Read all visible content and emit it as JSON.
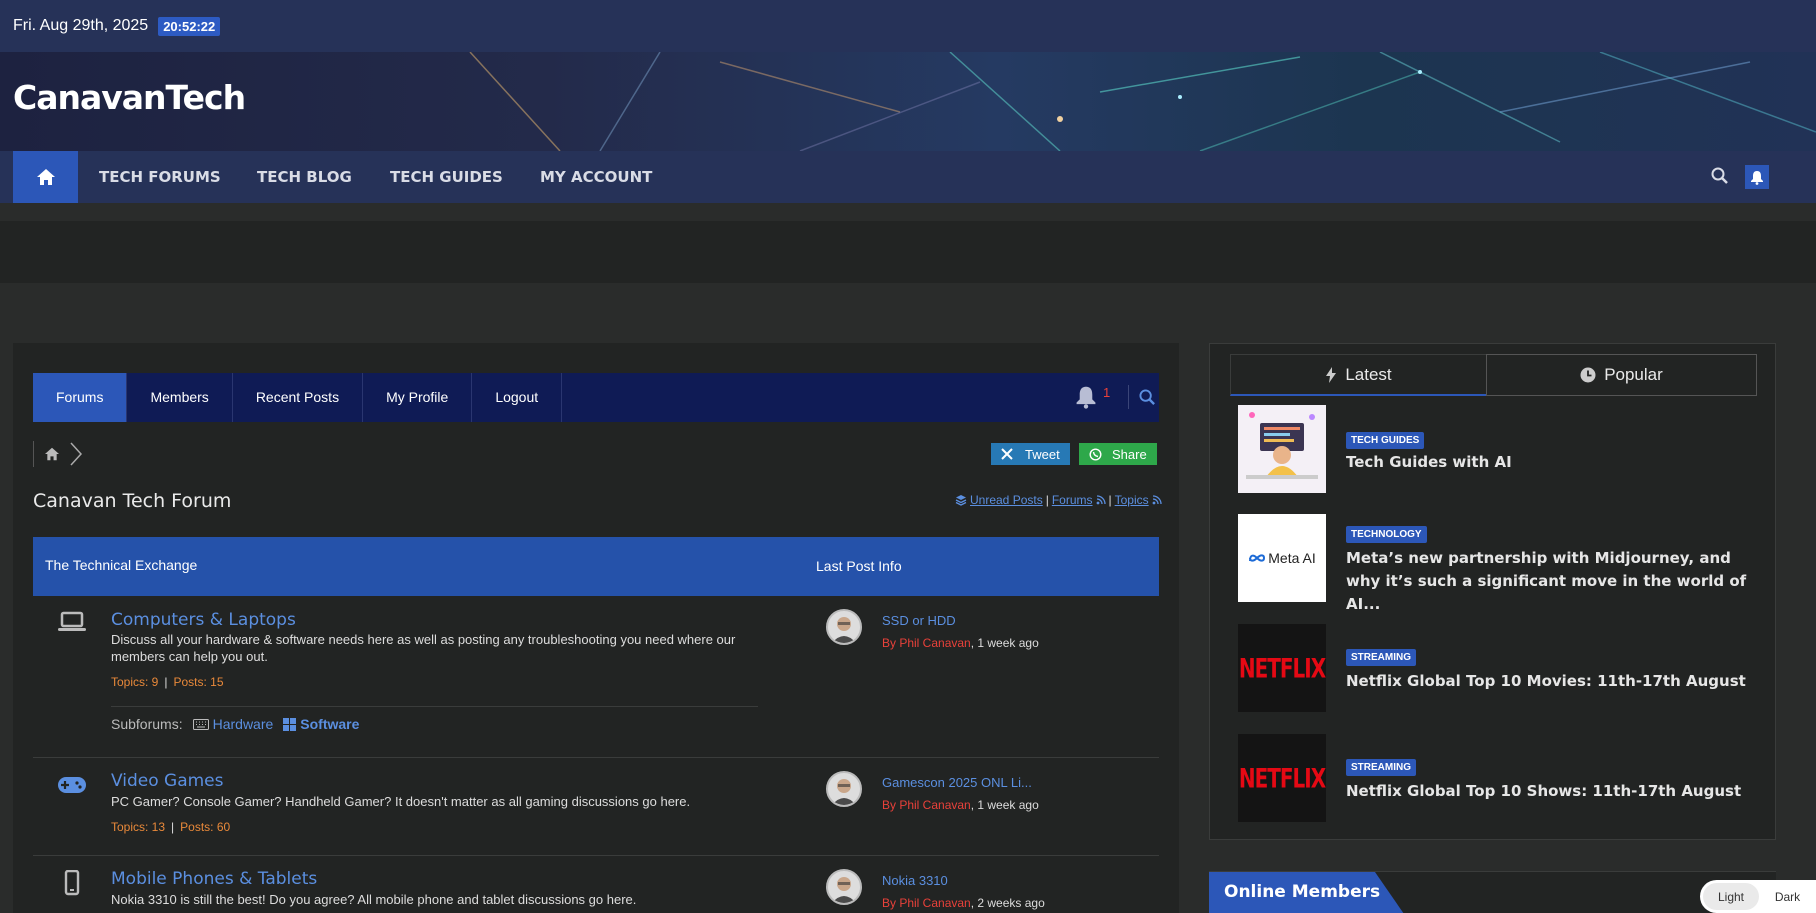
{
  "topbar": {
    "date": "Fri. Aug 29th, 2025",
    "time": "20:52:22"
  },
  "brand": "CanavanTech",
  "nav": {
    "items": [
      "TECH FORUMS",
      "TECH BLOG",
      "TECH GUIDES",
      "MY ACCOUNT"
    ],
    "icons": [
      "home-icon",
      "search-icon",
      "bell-icon"
    ]
  },
  "forum_tabs": {
    "items": [
      "Forums",
      "Members",
      "Recent Posts",
      "My Profile",
      "Logout"
    ],
    "notification_count": "1"
  },
  "share": {
    "tweet": "Tweet",
    "share": "Share"
  },
  "forum": {
    "title": "Canavan Tech Forum",
    "links": {
      "unread": "Unread Posts",
      "forums": "Forums",
      "topics": "Topics",
      "sep": "|"
    },
    "header": {
      "section": "The Technical Exchange",
      "last_post": "Last Post Info"
    }
  },
  "rows": [
    {
      "name": "Computers & Laptops",
      "desc": "Discuss all your hardware & software needs here as well as posting any troubleshooting you need where our members can help you out.",
      "topics": "Topics: 9",
      "posts": "Posts: 15",
      "subforums_label": "Subforums:",
      "subforums": [
        "Hardware",
        "Software"
      ],
      "last_title": "SSD or HDD",
      "last_user": "By Phil Canavan",
      "last_time": ", 1 week ago"
    },
    {
      "name": "Video Games",
      "desc": "PC Gamer? Console Gamer? Handheld Gamer? It doesn't matter as all gaming discussions go here.",
      "topics": "Topics: 13",
      "posts": "Posts: 60",
      "last_title": "Gamescon 2025 ONL Li...",
      "last_user": "By Phil Canavan",
      "last_time": ", 1 week ago"
    },
    {
      "name": "Mobile Phones & Tablets",
      "desc": "Nokia 3310 is still the best! Do you agree? All mobile phone and tablet discussions go here.",
      "last_title": "Nokia 3310",
      "last_user": "By Phil Canavan",
      "last_time": ", 2 weeks ago"
    }
  ],
  "sidebar": {
    "tabs": {
      "latest": "Latest",
      "popular": "Popular"
    },
    "news": [
      {
        "badge": "TECH GUIDES",
        "title": "Tech Guides with AI"
      },
      {
        "badge": "TECHNOLOGY",
        "title": "Meta’s new partnership with Midjourney, and why it’s such a significant move in the world of AI...",
        "thumb_text": "Meta AI"
      },
      {
        "badge": "STREAMING",
        "title": "Netflix Global Top 10 Movies: 11th-17th August",
        "thumb_text": "NETFLIX"
      },
      {
        "badge": "STREAMING",
        "title": "Netflix Global Top 10 Shows: 11th-17th August",
        "thumb_text": "NETFLIX"
      }
    ],
    "online_members": "Online Members"
  },
  "mode": {
    "light": "Light",
    "dark": "Dark"
  },
  "colors": {
    "accent": "#2c57b8",
    "topbar": "#263258",
    "tabs": "#0f1b55",
    "link": "#5b8fe0",
    "stat": "#e9893a",
    "user": "#e8413a"
  }
}
